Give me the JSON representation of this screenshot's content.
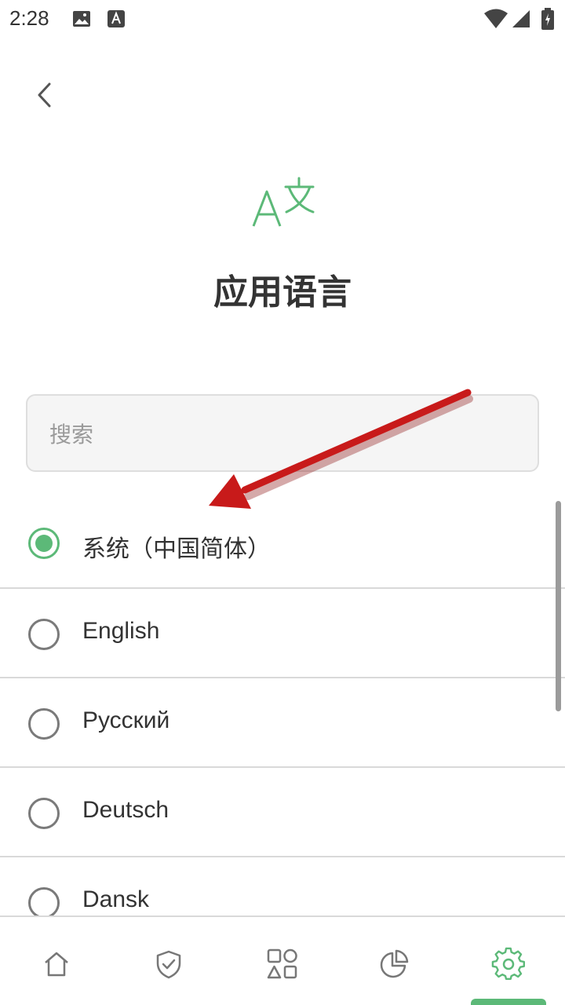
{
  "status_bar": {
    "time": "2:28",
    "icons": [
      "image-icon",
      "app-a-icon",
      "wifi-icon",
      "signal-icon",
      "battery-icon"
    ]
  },
  "back": {
    "icon": "chevron-left-icon"
  },
  "header": {
    "icon": "translate-icon",
    "title": "应用语言"
  },
  "search": {
    "placeholder": "搜索",
    "value": ""
  },
  "languages": [
    {
      "label": "系统（中国简体）",
      "selected": true
    },
    {
      "label": "English",
      "selected": false
    },
    {
      "label": "Русский",
      "selected": false
    },
    {
      "label": "Deutsch",
      "selected": false
    },
    {
      "label": "Dansk",
      "selected": false
    }
  ],
  "bottom_nav": {
    "items": [
      {
        "icon": "home-icon",
        "active": false
      },
      {
        "icon": "shield-check-icon",
        "active": false
      },
      {
        "icon": "apps-shapes-icon",
        "active": false
      },
      {
        "icon": "pie-chart-icon",
        "active": false
      },
      {
        "icon": "gear-icon",
        "active": true
      }
    ]
  },
  "colors": {
    "accent": "#5cb978",
    "text": "#333333",
    "placeholder": "#9a9a9a",
    "divider": "#d9d9d9",
    "annotation_arrow": "#c81a1a"
  }
}
